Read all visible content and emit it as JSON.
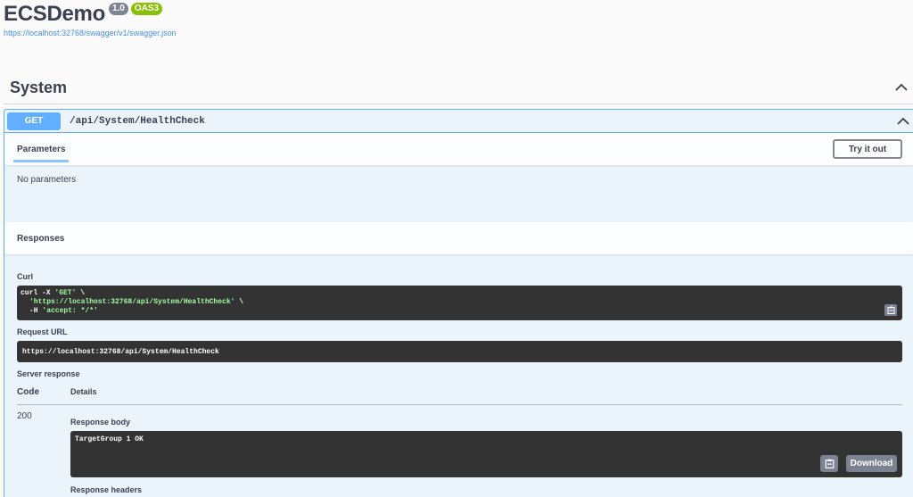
{
  "info": {
    "title": "ECSDemo",
    "version": "1.0",
    "oas_badge": "OAS3",
    "spec_url": "https://localhost:32768/swagger/v1/swagger.json"
  },
  "tag": {
    "name": "System"
  },
  "operation": {
    "method": "GET",
    "path": "/api/System/HealthCheck",
    "color": "#61affe"
  },
  "parameters": {
    "tab_label": "Parameters",
    "try_button": "Try it out",
    "empty_text": "No parameters"
  },
  "responses": {
    "header": "Responses",
    "curl_label": "Curl",
    "curl": {
      "line1_cmd": "curl -X ",
      "line1_method": "'GET'",
      "line1_tail": " \\",
      "line2_url": "'https://localhost:32768/api/System/HealthCheck'",
      "line2_tail": " \\",
      "line3_flag": "-H ",
      "line3_header": "'accept: */*'"
    },
    "request_url_label": "Request URL",
    "request_url": "https://localhost:32768/api/System/HealthCheck",
    "server_response_label": "Server response",
    "code_col": "Code",
    "details_col": "Details",
    "row": {
      "code": "200",
      "body_label": "Response body",
      "body": "TargetGroup 1 OK",
      "download_label": "Download",
      "headers_label": "Response headers"
    }
  },
  "icons": {
    "collapse": "chevron-up-icon",
    "copy": "clipboard-icon"
  }
}
